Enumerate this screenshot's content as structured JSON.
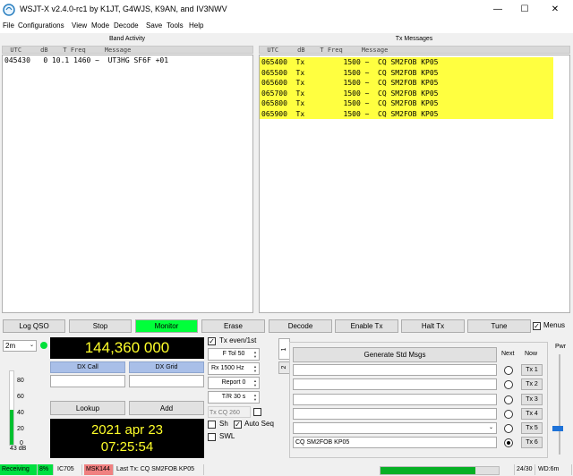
{
  "window": {
    "title": "WSJT-X   v2.4.0-rc1   by K1JT, G4WJS, K9AN, and IV3NWV",
    "minimize": "—",
    "maximize": "☐",
    "close": "✕"
  },
  "menu": [
    "File",
    "Configurations",
    "View",
    "Mode",
    "Decode",
    "Save",
    "Tools",
    "Help"
  ],
  "band_activity": {
    "title": "Band Activity",
    "header": "  UTC     dB    T Freq     Message",
    "rows": [
      "045430   0 10.1 1460 ~  UT3HG SF6F +01"
    ]
  },
  "tx_messages": {
    "title": "Tx Messages",
    "header": "  UTC     dB    T Freq     Message",
    "rows": [
      "065400  Tx         1500 ~  CQ SM2FOB KP05",
      "065500  Tx         1500 ~  CQ SM2FOB KP05",
      "065600  Tx         1500 ~  CQ SM2FOB KP05",
      "065700  Tx         1500 ~  CQ SM2FOB KP05",
      "065800  Tx         1500 ~  CQ SM2FOB KP05",
      "065900  Tx         1500 ~  CQ SM2FOB KP05"
    ],
    "highlight_color": "#ffff40"
  },
  "buttons": {
    "log_qso": "Log QSO",
    "stop": "Stop",
    "monitor": "Monitor",
    "erase": "Erase",
    "decode": "Decode",
    "enable_tx": "Enable Tx",
    "halt_tx": "Halt Tx",
    "tune": "Tune",
    "menus": "Menus"
  },
  "monitor_color": "#00ff3a",
  "band": {
    "selected": "2m"
  },
  "frequency": "144,360 000",
  "dx": {
    "call_label": "DX Call",
    "grid_label": "DX Grid",
    "call_value": "",
    "grid_value": "",
    "lookup": "Lookup",
    "add": "Add"
  },
  "date": "2021 apr 23",
  "time": "07:25:54",
  "level": {
    "ticks": [
      "80",
      "60",
      "40",
      "20",
      "0"
    ],
    "db": "43 dB",
    "value_db": 43
  },
  "controls": {
    "tx_even": "Tx even/1st",
    "f_tol": "F Tol  50",
    "rx_freq": "Rx  1500  Hz",
    "report": "Report  0",
    "tr": "T/R  30  s",
    "tx_cq": "Tx CQ 260",
    "sh": "Sh",
    "auto_seq": "Auto Seq",
    "swl": "SWL"
  },
  "tabs": [
    "1",
    "2"
  ],
  "std_msgs": {
    "generate": "Generate Std Msgs",
    "next": "Next",
    "now": "Now",
    "tx_buttons": [
      "Tx 1",
      "Tx 2",
      "Tx 3",
      "Tx 4",
      "Tx 5",
      "Tx 6"
    ],
    "msgs": [
      "",
      "",
      "",
      "",
      "",
      "CQ SM2FOB KP05"
    ],
    "selected_index": 5
  },
  "pwr": {
    "label": "Pwr"
  },
  "status": {
    "receiving": "Receiving",
    "pct": "8%",
    "rig": "IC705",
    "mode": "MSK144",
    "last_tx": "Last Tx: CQ SM2FOB KP05",
    "progress_pct": 80,
    "counter": "24/30",
    "wd": "WD:6m"
  }
}
